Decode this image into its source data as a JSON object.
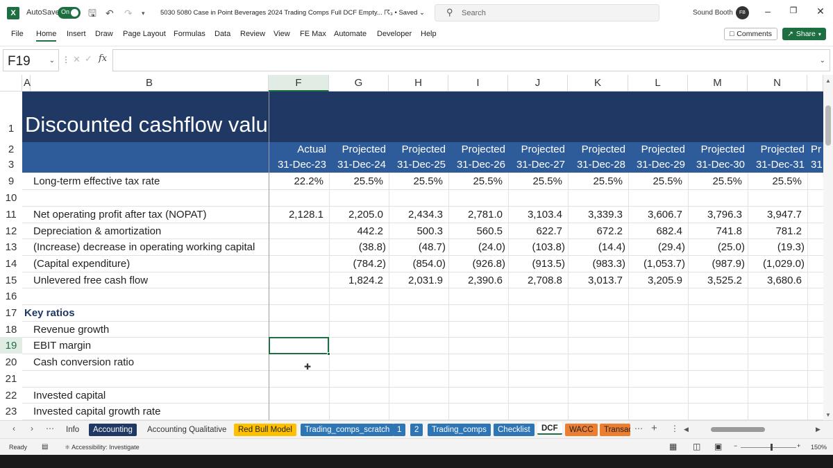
{
  "titlebar": {
    "app_icon": "X",
    "autosave_label": "AutoSave",
    "autosave_state": "On",
    "doc_title": "5030 5080 Case in Point Beverages 2024 Trading Comps Full DCF Empty...",
    "saved_label": "• Saved",
    "search_placeholder": "Search",
    "user_name": "Sound Booth",
    "avatar_initials": "FB"
  },
  "menu": {
    "items": [
      "File",
      "Home",
      "Insert",
      "Draw",
      "Page Layout",
      "Formulas",
      "Data",
      "Review",
      "View",
      "FE Max",
      "Automate",
      "Developer",
      "Help"
    ],
    "comments_label": "Comments",
    "share_label": "Share"
  },
  "formula_bar": {
    "name_box": "F19",
    "formula": ""
  },
  "grid": {
    "columns": [
      "A",
      "B",
      "F",
      "G",
      "H",
      "I",
      "J",
      "K",
      "L",
      "M",
      "N"
    ],
    "selected_column": "F",
    "selected_row": "19",
    "title": "Discounted cashflow valu",
    "period_type": [
      "Actual",
      "Projected",
      "Projected",
      "Projected",
      "Projected",
      "Projected",
      "Projected",
      "Projected",
      "Projected",
      "Pr"
    ],
    "period_dates": [
      "31-Dec-23",
      "31-Dec-24",
      "31-Dec-25",
      "31-Dec-26",
      "31-Dec-27",
      "31-Dec-28",
      "31-Dec-29",
      "31-Dec-30",
      "31-Dec-31",
      "31"
    ],
    "rows": [
      {
        "num": "1"
      },
      {
        "num": "2"
      },
      {
        "num": "3"
      },
      {
        "num": "9",
        "label": "Long-term effective tax rate",
        "values": [
          "22.2%",
          "25.5%",
          "25.5%",
          "25.5%",
          "25.5%",
          "25.5%",
          "25.5%",
          "25.5%",
          "25.5%"
        ]
      },
      {
        "num": "10",
        "label": "",
        "values": []
      },
      {
        "num": "11",
        "label": "Net operating profit after tax (NOPAT)",
        "values": [
          "2,128.1",
          "2,205.0",
          "2,434.3",
          "2,781.0",
          "3,103.4",
          "3,339.3",
          "3,606.7",
          "3,796.3",
          "3,947.7"
        ]
      },
      {
        "num": "12",
        "label": "Depreciation & amortization",
        "values": [
          "",
          "442.2",
          "500.3",
          "560.5",
          "622.7",
          "672.2",
          "682.4",
          "741.8",
          "781.2"
        ]
      },
      {
        "num": "13",
        "label": "(Increase) decrease in operating working capital",
        "values": [
          "",
          "(38.8)",
          "(48.7)",
          "(24.0)",
          "(103.8)",
          "(14.4)",
          "(29.4)",
          "(25.0)",
          "(19.3)"
        ]
      },
      {
        "num": "14",
        "label": "(Capital expenditure)",
        "values": [
          "",
          "(784.2)",
          "(854.0)",
          "(926.8)",
          "(913.5)",
          "(983.3)",
          "(1,053.7)",
          "(987.9)",
          "(1,029.0)"
        ]
      },
      {
        "num": "15",
        "label": "Unlevered free cash flow",
        "values": [
          "",
          "1,824.2",
          "2,031.9",
          "2,390.6",
          "2,708.8",
          "3,013.7",
          "3,205.9",
          "3,525.2",
          "3,680.6"
        ]
      },
      {
        "num": "16",
        "label": "",
        "values": []
      },
      {
        "num": "17",
        "label": "Key ratios",
        "bold": true,
        "values": []
      },
      {
        "num": "18",
        "label": "Revenue growth",
        "values": []
      },
      {
        "num": "19",
        "label": "EBIT margin",
        "values": []
      },
      {
        "num": "20",
        "label": "Cash conversion ratio",
        "values": []
      },
      {
        "num": "21",
        "label": "",
        "values": []
      },
      {
        "num": "22",
        "label": "Invested capital",
        "values": []
      },
      {
        "num": "23",
        "label": "Invested capital growth rate",
        "values": []
      }
    ]
  },
  "sheet_tabs": [
    {
      "label": "Info",
      "bg": "",
      "fg": "#333333"
    },
    {
      "label": "Accounting",
      "bg": "#1f3864",
      "fg": "#ffffff"
    },
    {
      "label": "Accounting Qualitative",
      "bg": "",
      "fg": "#333333"
    },
    {
      "label": "Red Bull Model",
      "bg": "#ffc000",
      "fg": "#222222"
    },
    {
      "label": "Trading_comps_scratch",
      "bg": "#2e75b6",
      "fg": "#ffffff"
    },
    {
      "label": "1",
      "bg": "#2e75b6",
      "fg": "#ffffff"
    },
    {
      "label": "2",
      "bg": "#2e75b6",
      "fg": "#ffffff"
    },
    {
      "label": "Trading_comps",
      "bg": "#2e75b6",
      "fg": "#ffffff"
    },
    {
      "label": "Checklist",
      "bg": "#2e75b6",
      "fg": "#ffffff"
    },
    {
      "label": "DCF",
      "bg": "#ffffff",
      "fg": "#222222",
      "active": true
    },
    {
      "label": "WACC",
      "bg": "#ed7d31",
      "fg": "#222222"
    },
    {
      "label": "Transac",
      "bg": "#ed7d31",
      "fg": "#222222"
    }
  ],
  "statusbar": {
    "ready": "Ready",
    "accessibility": "Accessibility: Investigate",
    "zoom": "150%"
  },
  "colors": {
    "title_band": "#1f3864",
    "header_band": "#2e5c9a",
    "excel_green": "#1d6f42"
  }
}
